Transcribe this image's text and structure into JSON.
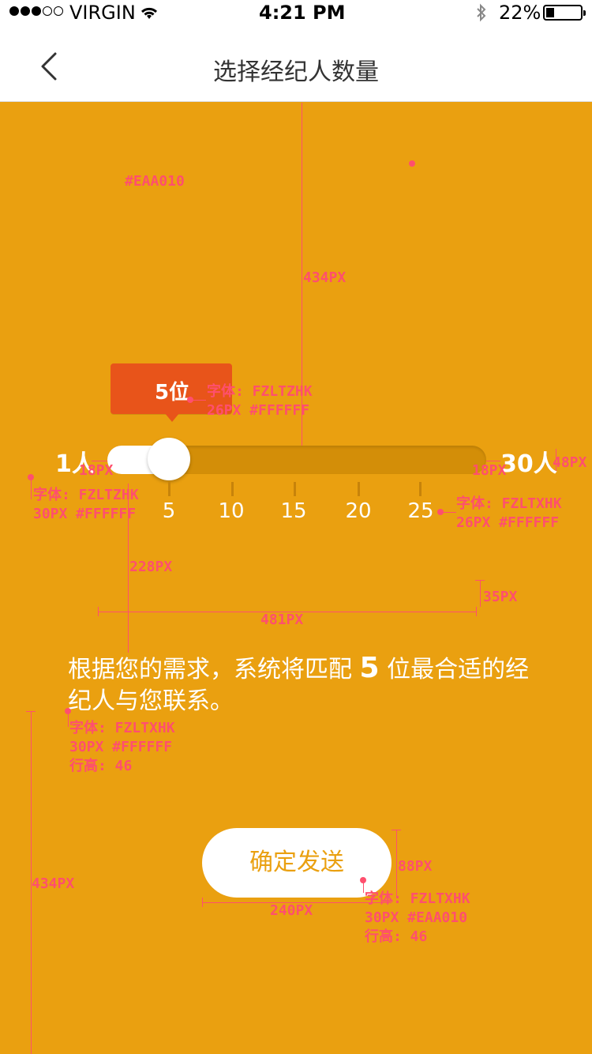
{
  "status": {
    "carrier": "VIRGIN",
    "time": "4:21 PM",
    "battery": "22%"
  },
  "nav": {
    "title": "选择经纪人数量"
  },
  "slider": {
    "value_label": "5位",
    "min_label": "1人",
    "max_label": "30人",
    "ticks": [
      "5",
      "10",
      "15",
      "20",
      "25"
    ],
    "value": 5,
    "min": 1,
    "max": 30
  },
  "description": {
    "before": "根据您的需求，系统将匹配",
    "number": "5",
    "after": "位最合适的经纪人与您联系。"
  },
  "confirm_label": "确定发送",
  "annotations": {
    "bg_color": "#EAA010",
    "h_434_top": "434PX",
    "tooltip_font_1": "字体: FZLTZHK",
    "tooltip_font_2": "26PX #FFFFFF",
    "left_pad": "18PX",
    "right_pad": "18PX",
    "height_48": "48PX",
    "range_font_1": "字体: FZLTZHK",
    "range_font_2": "30PX #FFFFFF",
    "tick_font_1": "字体: FZLTXHK",
    "tick_font_2": "26PX #FFFFFF",
    "gap_228": "228PX",
    "gap_35": "35PX",
    "width_481": "481PX",
    "desc_font_1": "字体: FZLTXHK",
    "desc_font_2": "30PX #FFFFFF",
    "desc_font_3": "行高: 46",
    "h_434_bottom": "434PX",
    "height_88": "88PX",
    "width_240": "240PX",
    "btn_font_1": "字体: FZLTXHK",
    "btn_font_2": "30PX #EAA010",
    "btn_font_3": "行高: 46"
  }
}
